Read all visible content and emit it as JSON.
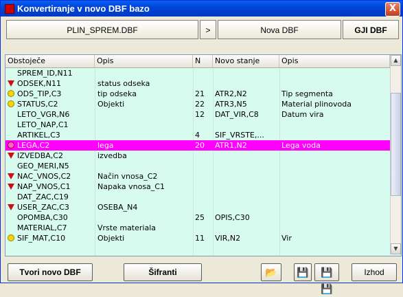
{
  "window": {
    "title": "Konvertiranje v novo DBF bazo",
    "close_label": "X"
  },
  "header": {
    "source_file": "PLIN_SPREM.DBF",
    "arrow": ">",
    "target": "Nova DBF",
    "gji_label": "GJI DBF"
  },
  "columns": {
    "obstojece": "Obstoječe",
    "opis1": "Opis",
    "n": "N",
    "novo_stanje": "Novo stanje",
    "opis2": "Opis"
  },
  "rows": [
    {
      "icon": "none",
      "field": "SPREM_ID,N11",
      "opis": "",
      "n": "",
      "novo": "",
      "opis2": ""
    },
    {
      "icon": "red-triangle-icon",
      "field": "ODSEK,N11",
      "opis": "status odseka",
      "n": "",
      "novo": "",
      "opis2": ""
    },
    {
      "icon": "smiley-icon",
      "field": "ODS_TIP,C3",
      "opis": "tip odseka",
      "n": "21",
      "novo": "ATR2,N2",
      "opis2": "Tip segmenta"
    },
    {
      "icon": "smiley-icon",
      "field": "STATUS,C2",
      "opis": "Objekti",
      "n": "22",
      "novo": "ATR3,N5",
      "opis2": "Material plinovoda"
    },
    {
      "icon": "none",
      "field": "LETO_VGR,N6",
      "opis": "",
      "n": "12",
      "novo": "DAT_VIR,C8",
      "opis2": "Datum vira"
    },
    {
      "icon": "none",
      "field": "LETO_NAP,C1",
      "opis": "",
      "n": "",
      "novo": "",
      "opis2": ""
    },
    {
      "icon": "none",
      "field": "ARTIKEL,C3",
      "opis": "",
      "n": "4",
      "novo": "SIF_VRSTE,...",
      "opis2": ""
    },
    {
      "icon": "smiley-icon",
      "field": "LEGA,C2",
      "opis": "lega",
      "n": "20",
      "novo": "ATR1,N2",
      "opis2": "Lega voda",
      "selected": true
    },
    {
      "icon": "red-triangle-icon",
      "field": "IZVEDBA,C2",
      "opis": "izvedba",
      "n": "",
      "novo": "",
      "opis2": ""
    },
    {
      "icon": "none",
      "field": "GEO_MERI,N5",
      "opis": "",
      "n": "",
      "novo": "",
      "opis2": ""
    },
    {
      "icon": "red-triangle-icon",
      "field": "NAC_VNOS,C2",
      "opis": "Način vnosa_C2",
      "n": "",
      "novo": "",
      "opis2": ""
    },
    {
      "icon": "red-triangle-icon",
      "field": "NAP_VNOS,C1",
      "opis": "Napaka vnosa_C1",
      "n": "",
      "novo": "",
      "opis2": ""
    },
    {
      "icon": "none",
      "field": "DAT_ZAC,C19",
      "opis": "",
      "n": "",
      "novo": "",
      "opis2": ""
    },
    {
      "icon": "red-triangle-icon",
      "field": "USER_ZAC,C3",
      "opis": "OSEBA_N4",
      "n": "",
      "novo": "",
      "opis2": ""
    },
    {
      "icon": "none",
      "field": "OPOMBA,C30",
      "opis": "",
      "n": "25",
      "novo": "OPIS,C30",
      "opis2": ""
    },
    {
      "icon": "none",
      "field": "MATERIAL,C7",
      "opis": "Vrste materiala",
      "n": "",
      "novo": "",
      "opis2": ""
    },
    {
      "icon": "smiley-icon",
      "field": "SIF_MAT,C10",
      "opis": "Objekti",
      "n": "11",
      "novo": "VIR,N2",
      "opis2": "Vir"
    }
  ],
  "buttons": {
    "tvori": "Tvori novo DBF",
    "sifranti": "Šifranti",
    "izhod": "Izhod",
    "open_icon": "📂",
    "save_icon": "💾",
    "save_all_icon": "💾💾"
  },
  "colors": {
    "selected_row": "#ff00ff",
    "grid_bg": "#d8fbf0"
  }
}
